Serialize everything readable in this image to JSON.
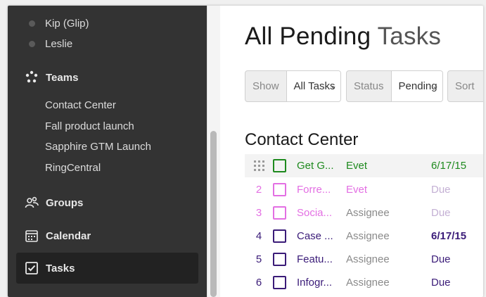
{
  "sidebar": {
    "people": [
      "Kip (Glip)",
      "Leslie"
    ],
    "teams_label": "Teams",
    "teams": [
      "Contact Center",
      "Fall product launch",
      "Sapphire GTM Launch",
      "RingCentral"
    ],
    "groups_label": "Groups",
    "calendar_label": "Calendar",
    "tasks_label": "Tasks"
  },
  "main": {
    "title_part1": "All Pending",
    "title_part2": "Tasks",
    "filters": {
      "show_label": "Show",
      "show_value": "All Tasks",
      "status_label": "Status",
      "status_value": "Pending",
      "sort_label": "Sort"
    },
    "section_title": "Contact Center",
    "tasks": [
      {
        "num": "",
        "name": "Get G...",
        "assignee": "Evet",
        "due": "6/17/15",
        "color": "#1e8a1e"
      },
      {
        "num": "2",
        "name": "Forre...",
        "assignee": "Evet",
        "due": "Due",
        "color": "#e36fe3"
      },
      {
        "num": "3",
        "name": "Socia...",
        "assignee": "Assignee",
        "due": "Due",
        "color": "#e36fe3"
      },
      {
        "num": "4",
        "name": "Case ...",
        "assignee": "Assignee",
        "due": "6/17/15",
        "color": "#3a1b78"
      },
      {
        "num": "5",
        "name": "Featu...",
        "assignee": "Assignee",
        "due": "Due",
        "color": "#3a1b78"
      },
      {
        "num": "6",
        "name": "Infogr...",
        "assignee": "Assignee",
        "due": "Due",
        "color": "#3a1b78"
      }
    ]
  },
  "colors": {
    "sidebar_bg": "#333333",
    "active_bg": "#222222",
    "green": "#1e8a1e",
    "pink": "#e36fe3",
    "purple": "#3a1b78"
  },
  "icons": {
    "teams": "teams-icon",
    "groups": "groups-icon",
    "calendar": "calendar-icon",
    "tasks": "task-check-icon"
  }
}
